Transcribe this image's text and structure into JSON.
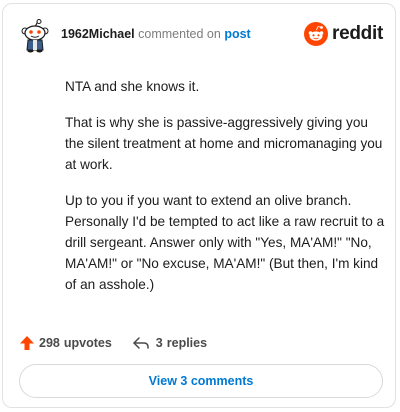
{
  "comment": {
    "username": "1962Michael",
    "action_text": " commented on ",
    "post_link": "post",
    "paragraphs": [
      "NTA and she knows it.",
      "That is why she is passive-aggressively giving you the silent treatment at home and micromanaging you at work.",
      "Up to you if you want to extend an olive branch. Personally I'd be tempted to act like a raw recruit to a drill sergeant. Answer only with \"Yes, MA'AM!\" \"No, MA'AM!\" or \"No excuse, MA'AM!\" (But then, I'm kind of an asshole.)"
    ]
  },
  "brand": {
    "name": "reddit",
    "icon": "reddit-snoo-icon",
    "color": "#ff4500"
  },
  "actions": {
    "upvote_count": "298",
    "upvote_label": "upvotes",
    "upvote_icon": "upvote-arrow-icon",
    "upvote_color": "#ff4500",
    "reply_count": "3",
    "reply_label": "replies",
    "reply_icon": "reply-arrow-icon"
  },
  "view_comments_label": "View 3 comments",
  "colors": {
    "link": "#0079d3",
    "text": "#1c1c1c",
    "muted": "#7c7c7c"
  }
}
